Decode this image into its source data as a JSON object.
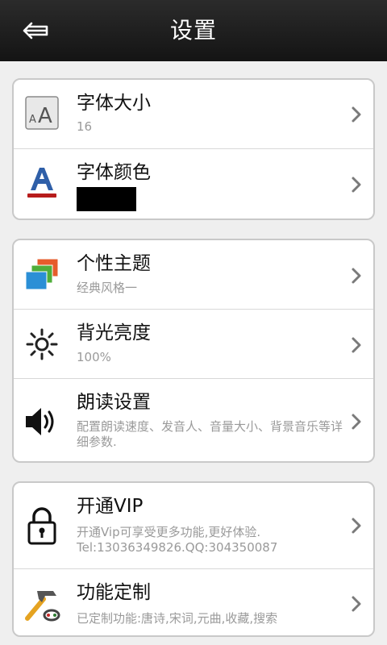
{
  "header": {
    "title": "设置",
    "back_icon": "back-arrow-icon"
  },
  "groups": [
    {
      "items": [
        {
          "label": "字体大小",
          "value": "16",
          "icon": "font-size-icon"
        },
        {
          "label": "字体颜色",
          "swatch_color": "#000000",
          "icon": "font-color-icon"
        }
      ]
    },
    {
      "items": [
        {
          "label": "个性主题",
          "value": "经典风格一",
          "icon": "theme-icon"
        },
        {
          "label": "背光亮度",
          "value": "100%",
          "icon": "brightness-icon"
        },
        {
          "label": "朗读设置",
          "value": "配置朗读速度、发音人、音量大小、背景音乐等详细参数.",
          "icon": "speaker-icon"
        }
      ]
    },
    {
      "items": [
        {
          "label": "开通VIP",
          "value": "开通Vip可享受更多功能,更好体验.",
          "value2": "Tel:13036349826.QQ:304350087",
          "icon": "lock-icon"
        },
        {
          "label": "功能定制",
          "value": "已定制功能:唐诗,宋词,元曲,收藏,搜索",
          "icon": "tools-icon"
        }
      ]
    }
  ],
  "chevron_icon": "chevron-right-icon",
  "colors": {
    "header_bg": "#1e1e1e",
    "page_bg": "#efefef",
    "card_border": "#c9c9c9",
    "subtext": "#9a9a9a"
  }
}
